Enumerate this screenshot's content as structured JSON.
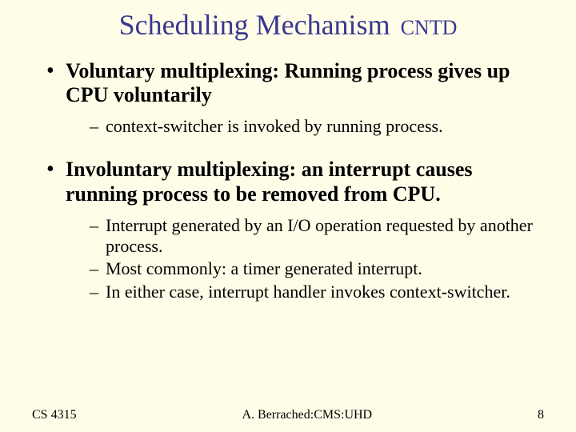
{
  "title": {
    "main": "Scheduling Mechanism",
    "suffix": "CNTD"
  },
  "bullets": [
    {
      "label": "Voluntary multiplexing:  Running process gives up CPU voluntarily",
      "sub": [
        "context-switcher is invoked by running process."
      ]
    },
    {
      "label": "Involuntary multiplexing: an interrupt causes running process to be removed from CPU.",
      "sub": [
        "Interrupt generated by an I/O operation requested by another process.",
        "Most commonly: a timer generated  interrupt.",
        "In either case, interrupt handler invokes context-switcher."
      ]
    }
  ],
  "footer": {
    "left": "CS 4315",
    "center": "A. Berrached:CMS:UHD",
    "right": "8"
  }
}
